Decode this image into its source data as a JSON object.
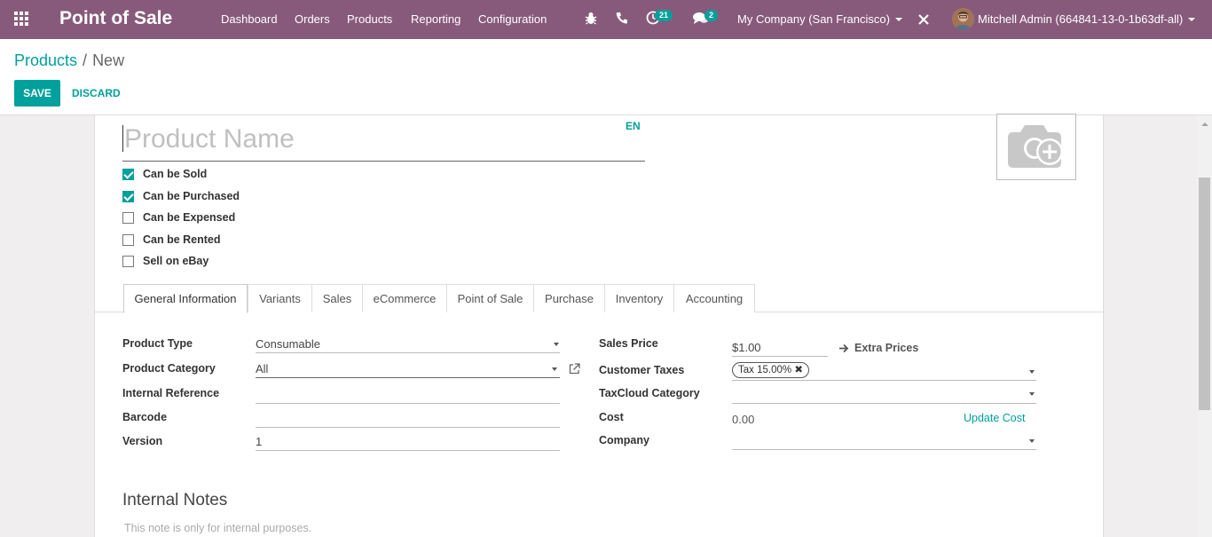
{
  "navbar": {
    "app_name": "Point of Sale",
    "menu": [
      "Dashboard",
      "Orders",
      "Products",
      "Reporting",
      "Configuration"
    ],
    "activity_count": "21",
    "message_count": "2",
    "company": "My Company (San Francisco)",
    "user": "Mitchell Admin (664841-13-0-1b63df-all)",
    "color": "#875a7b"
  },
  "breadcrumb": {
    "parent": "Products",
    "separator": "/",
    "current": "New"
  },
  "toolbar": {
    "save_label": "SAVE",
    "discard_label": "DISCARD"
  },
  "form": {
    "product_name_placeholder": "Product Name",
    "lang": "EN",
    "checkboxes": [
      {
        "label": "Can be Sold",
        "checked": true
      },
      {
        "label": "Can be Purchased",
        "checked": true
      },
      {
        "label": "Can be Expensed",
        "checked": false
      },
      {
        "label": "Can be Rented",
        "checked": false
      },
      {
        "label": "Sell on eBay",
        "checked": false
      }
    ],
    "tabs": [
      "General Information",
      "Variants",
      "Sales",
      "eCommerce",
      "Point of Sale",
      "Purchase",
      "Inventory",
      "Accounting"
    ],
    "active_tab": "General Information",
    "left_fields": {
      "product_type": {
        "label": "Product Type",
        "value": "Consumable"
      },
      "product_category": {
        "label": "Product Category",
        "value": "All"
      },
      "internal_reference": {
        "label": "Internal Reference",
        "value": ""
      },
      "barcode": {
        "label": "Barcode",
        "value": ""
      },
      "version": {
        "label": "Version",
        "value": "1"
      }
    },
    "right_fields": {
      "sales_price": {
        "label": "Sales Price",
        "value": "$1.00",
        "extra": "Extra Prices"
      },
      "customer_taxes": {
        "label": "Customer Taxes",
        "tag": "Tax 15.00%"
      },
      "taxcloud_category": {
        "label": "TaxCloud Category",
        "value": ""
      },
      "cost": {
        "label": "Cost",
        "value": "0.00",
        "action": "Update Cost"
      },
      "company": {
        "label": "Company",
        "value": ""
      }
    },
    "notes_title": "Internal Notes",
    "notes_placeholder": "This note is only for internal purposes."
  },
  "accent_color": "#00a09d"
}
